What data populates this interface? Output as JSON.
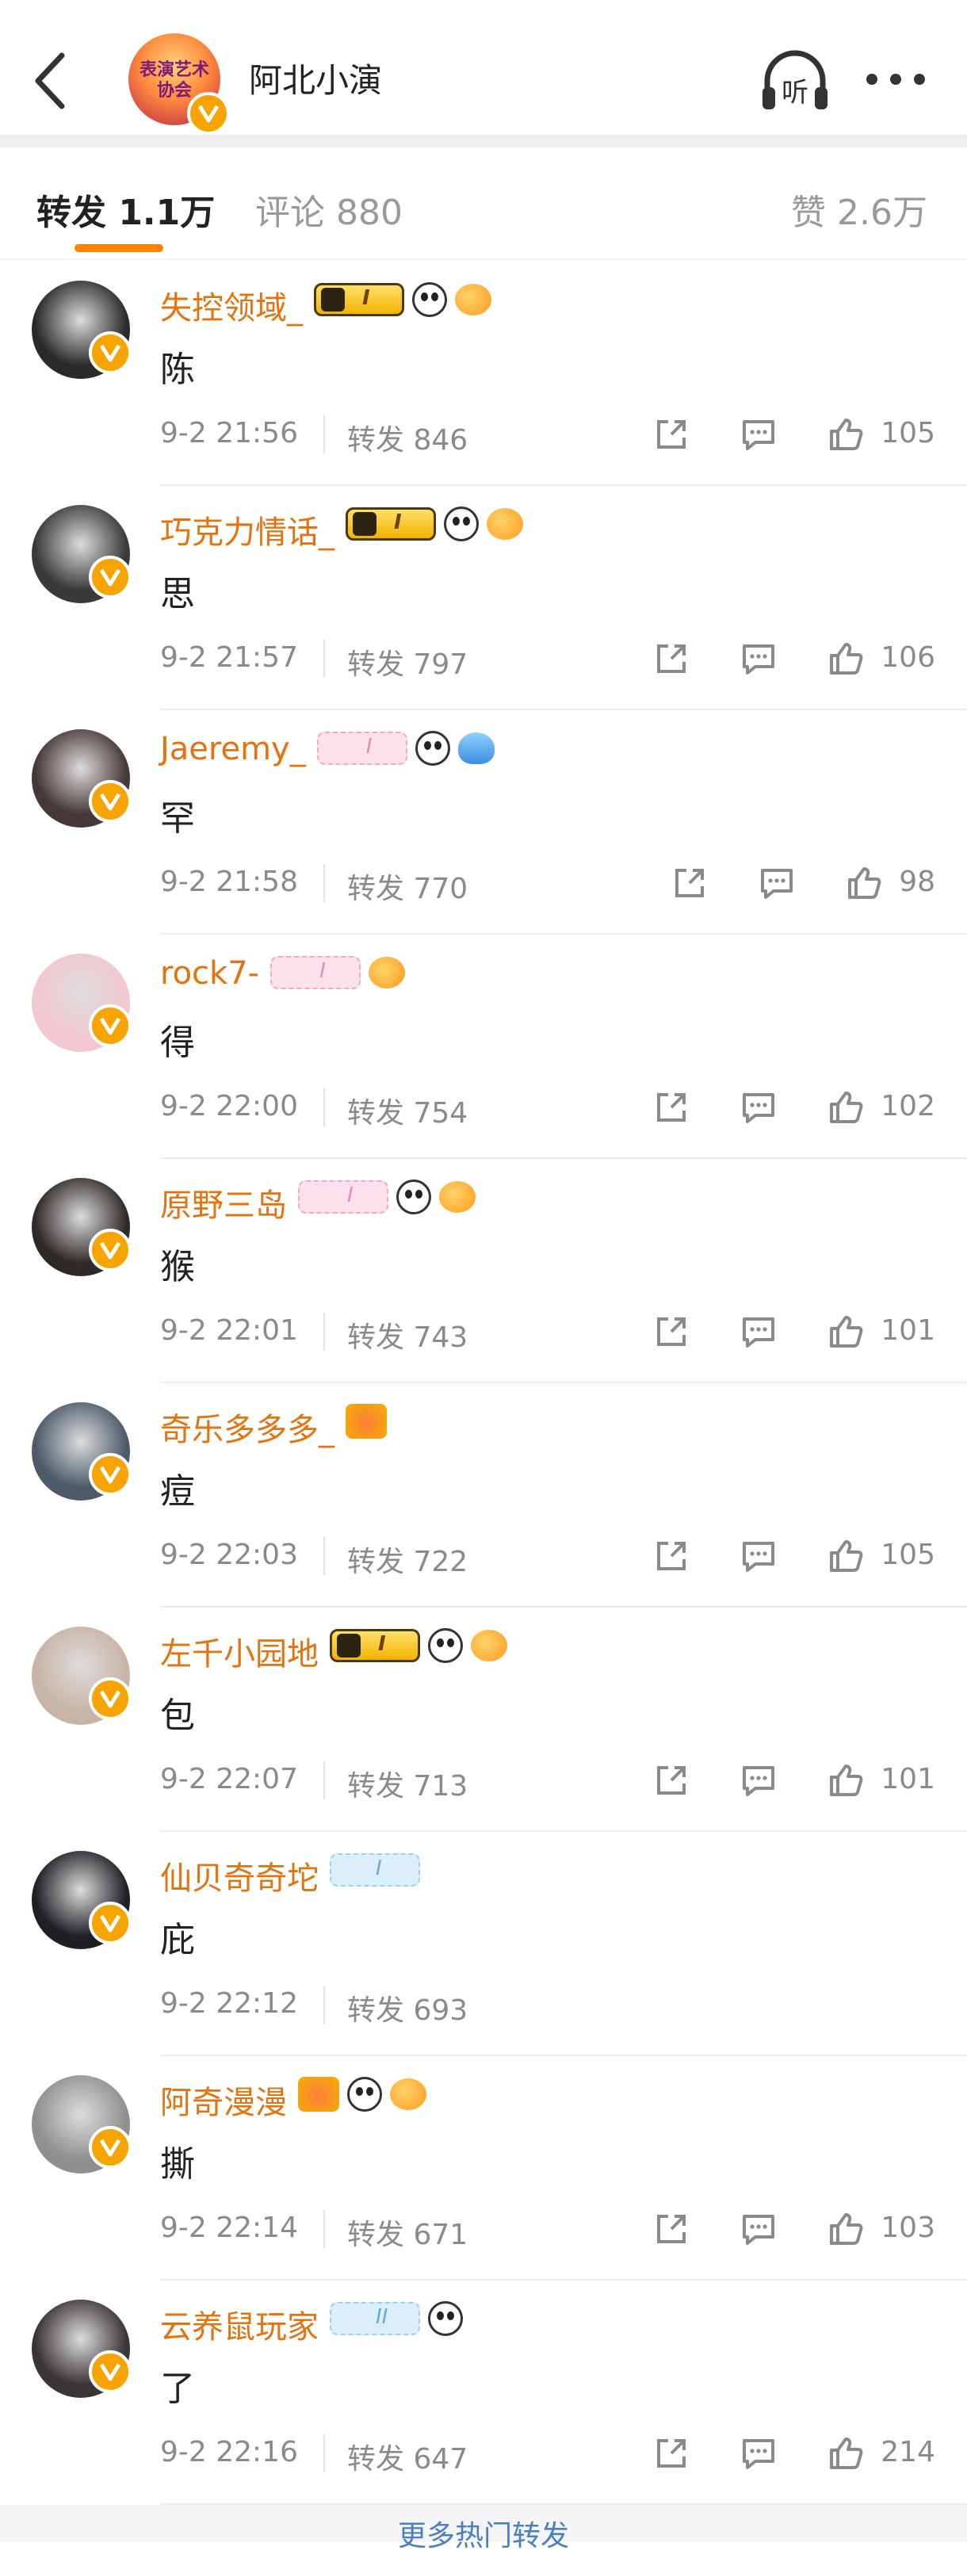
{
  "header": {
    "title": "阿北小演",
    "logo_text": "表演艺术协会"
  },
  "tabs": [
    {
      "label": "转发 1.1万"
    },
    {
      "label": "评论 880"
    },
    {
      "label": "赞 2.6万"
    }
  ],
  "colors": {
    "accent": "#ff8200",
    "name": "#e3730e",
    "muted": "#8a8a8a",
    "verified": "#f7a300"
  },
  "items": [
    {
      "name": "失控领域_",
      "content": "陈",
      "time": "9-2 21:56",
      "repost": "转发 846",
      "likes": "105",
      "badges": [
        "crown-level-badge",
        "panda-badge",
        "fish-badge"
      ],
      "avatar": "#2a2a2a"
    },
    {
      "name": "巧克力情话_",
      "content": "思",
      "time": "9-2 21:57",
      "repost": "转发 797",
      "likes": "106",
      "badges": [
        "crown-level-badge",
        "panda-badge",
        "fish-badge"
      ],
      "avatar": "#3a3a3a"
    },
    {
      "name": "Jaeremy_",
      "content": "罕",
      "time": "9-2 21:58",
      "repost": "转发 770",
      "likes": "98",
      "badges": [
        "pink-level-badge",
        "panda-badge",
        "shark-badge"
      ],
      "avatar": "#453836"
    },
    {
      "name": "rock7-",
      "content": "得",
      "time": "9-2 22:00",
      "repost": "转发 754",
      "likes": "102",
      "badges": [
        "pink-level-badge",
        "fish-badge"
      ],
      "avatar": "#f2c7cf"
    },
    {
      "name": "原野三岛",
      "content": "猴",
      "time": "9-2 22:01",
      "repost": "转发 743",
      "likes": "101",
      "badges": [
        "pink-level-badge",
        "panda-badge",
        "fish-badge"
      ],
      "avatar": "#2f2a28"
    },
    {
      "name": "奇乐多多多_",
      "content": "痘",
      "time": "9-2 22:03",
      "repost": "转发 722",
      "likes": "105",
      "badges": [
        "gold-badge"
      ],
      "avatar": "#4c5a6a"
    },
    {
      "name": "左千小园地",
      "content": "包",
      "time": "9-2 22:07",
      "repost": "转发 713",
      "likes": "101",
      "badges": [
        "crown-level-badge",
        "panda-badge",
        "fish-badge"
      ],
      "avatar": "#c9b3a5"
    },
    {
      "name": "仙贝奇奇坨",
      "content": "庇",
      "time": "9-2 22:12",
      "repost": "转发 693",
      "likes": "",
      "badges": [
        "blue-level-badge"
      ],
      "avatar": "#1e2024"
    },
    {
      "name": "阿奇漫漫",
      "content": "撕",
      "time": "9-2 22:14",
      "repost": "转发 671",
      "likes": "103",
      "badges": [
        "gold-badge",
        "panda-badge",
        "fish-badge"
      ],
      "avatar": "#8f8f8f"
    },
    {
      "name": "云养鼠玩家",
      "content": "了",
      "time": "9-2 22:16",
      "repost": "转发 647",
      "likes": "214",
      "badges": [
        "blue-level-badge-2",
        "panda-badge"
      ],
      "avatar": "#3b3434"
    }
  ],
  "level_text": {
    "one": "I",
    "two": "II"
  },
  "more_link": "更多热门转发"
}
